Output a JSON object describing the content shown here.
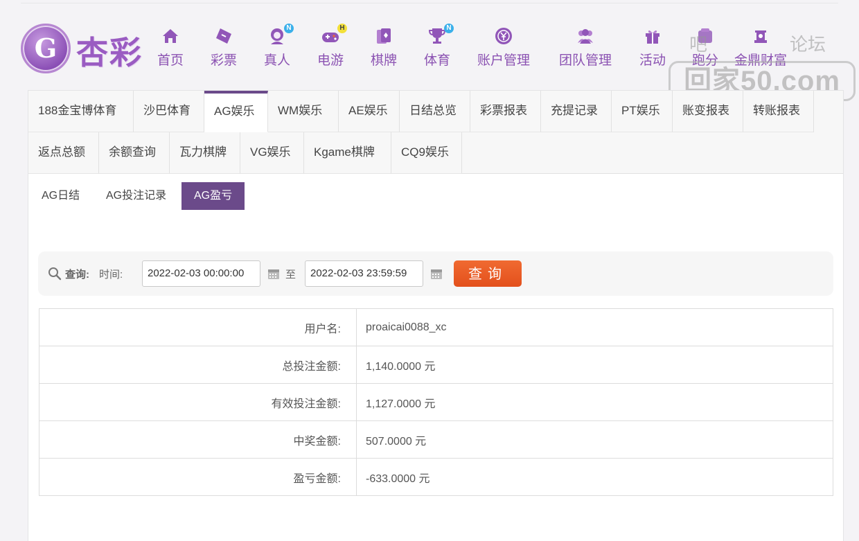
{
  "brand": {
    "logo_letter": "G",
    "logo_text": "杏彩"
  },
  "nav": [
    {
      "label": "首页",
      "icon": "home-icon",
      "badge": ""
    },
    {
      "label": "彩票",
      "icon": "ticket-icon",
      "badge": ""
    },
    {
      "label": "真人",
      "icon": "live-dealer-icon",
      "badge": "N"
    },
    {
      "label": "电游",
      "icon": "gamepad-icon",
      "badge": "H"
    },
    {
      "label": "棋牌",
      "icon": "cards-icon",
      "badge": ""
    },
    {
      "label": "体育",
      "icon": "trophy-icon",
      "badge": "N"
    },
    {
      "label": "账户管理",
      "icon": "coin-icon",
      "badge": ""
    },
    {
      "label": "团队管理",
      "icon": "team-icon",
      "badge": ""
    },
    {
      "label": "活动",
      "icon": "gift-icon",
      "badge": ""
    },
    {
      "label": "跑分",
      "icon": "run-icon",
      "badge": ""
    },
    {
      "label": "金鼎财富",
      "icon": "wealth-icon",
      "badge": ""
    }
  ],
  "watermark": {
    "line1": "吧",
    "line1b": "论坛",
    "box": "回家50.com"
  },
  "tabs": [
    {
      "label": "188金宝博体育",
      "active": false
    },
    {
      "label": "沙巴体育",
      "active": false
    },
    {
      "label": "AG娱乐",
      "active": true
    },
    {
      "label": "WM娱乐",
      "active": false
    },
    {
      "label": "AE娱乐",
      "active": false
    },
    {
      "label": "日结总览",
      "active": false
    },
    {
      "label": "彩票报表",
      "active": false
    },
    {
      "label": "充提记录",
      "active": false
    },
    {
      "label": "PT娱乐",
      "active": false
    },
    {
      "label": "账变报表",
      "active": false
    },
    {
      "label": "转账报表",
      "active": false
    },
    {
      "label": "返点总额",
      "active": false
    },
    {
      "label": "余额查询",
      "active": false
    },
    {
      "label": "瓦力棋牌",
      "active": false
    },
    {
      "label": "VG娱乐",
      "active": false
    },
    {
      "label": "Kgame棋牌",
      "active": false
    },
    {
      "label": "CQ9娱乐",
      "active": false
    }
  ],
  "subtabs": [
    {
      "label": "AG日结",
      "active": false
    },
    {
      "label": "AG投注记录",
      "active": false
    },
    {
      "label": "AG盈亏",
      "active": true
    }
  ],
  "search": {
    "query_label": "查询:",
    "time_label": "时间:",
    "start": "2022-02-03 00:00:00",
    "to_label": "至",
    "end": "2022-02-03 23:59:59",
    "button": "查询"
  },
  "result": [
    {
      "key": "用户名:",
      "value": "proaicai0088_xc"
    },
    {
      "key": "总投注金额:",
      "value": "1,140.0000 元"
    },
    {
      "key": "有效投注金额:",
      "value": "1,127.0000 元"
    },
    {
      "key": "中奖金额:",
      "value": "507.0000 元"
    },
    {
      "key": "盈亏金额:",
      "value": "-633.0000 元"
    }
  ]
}
